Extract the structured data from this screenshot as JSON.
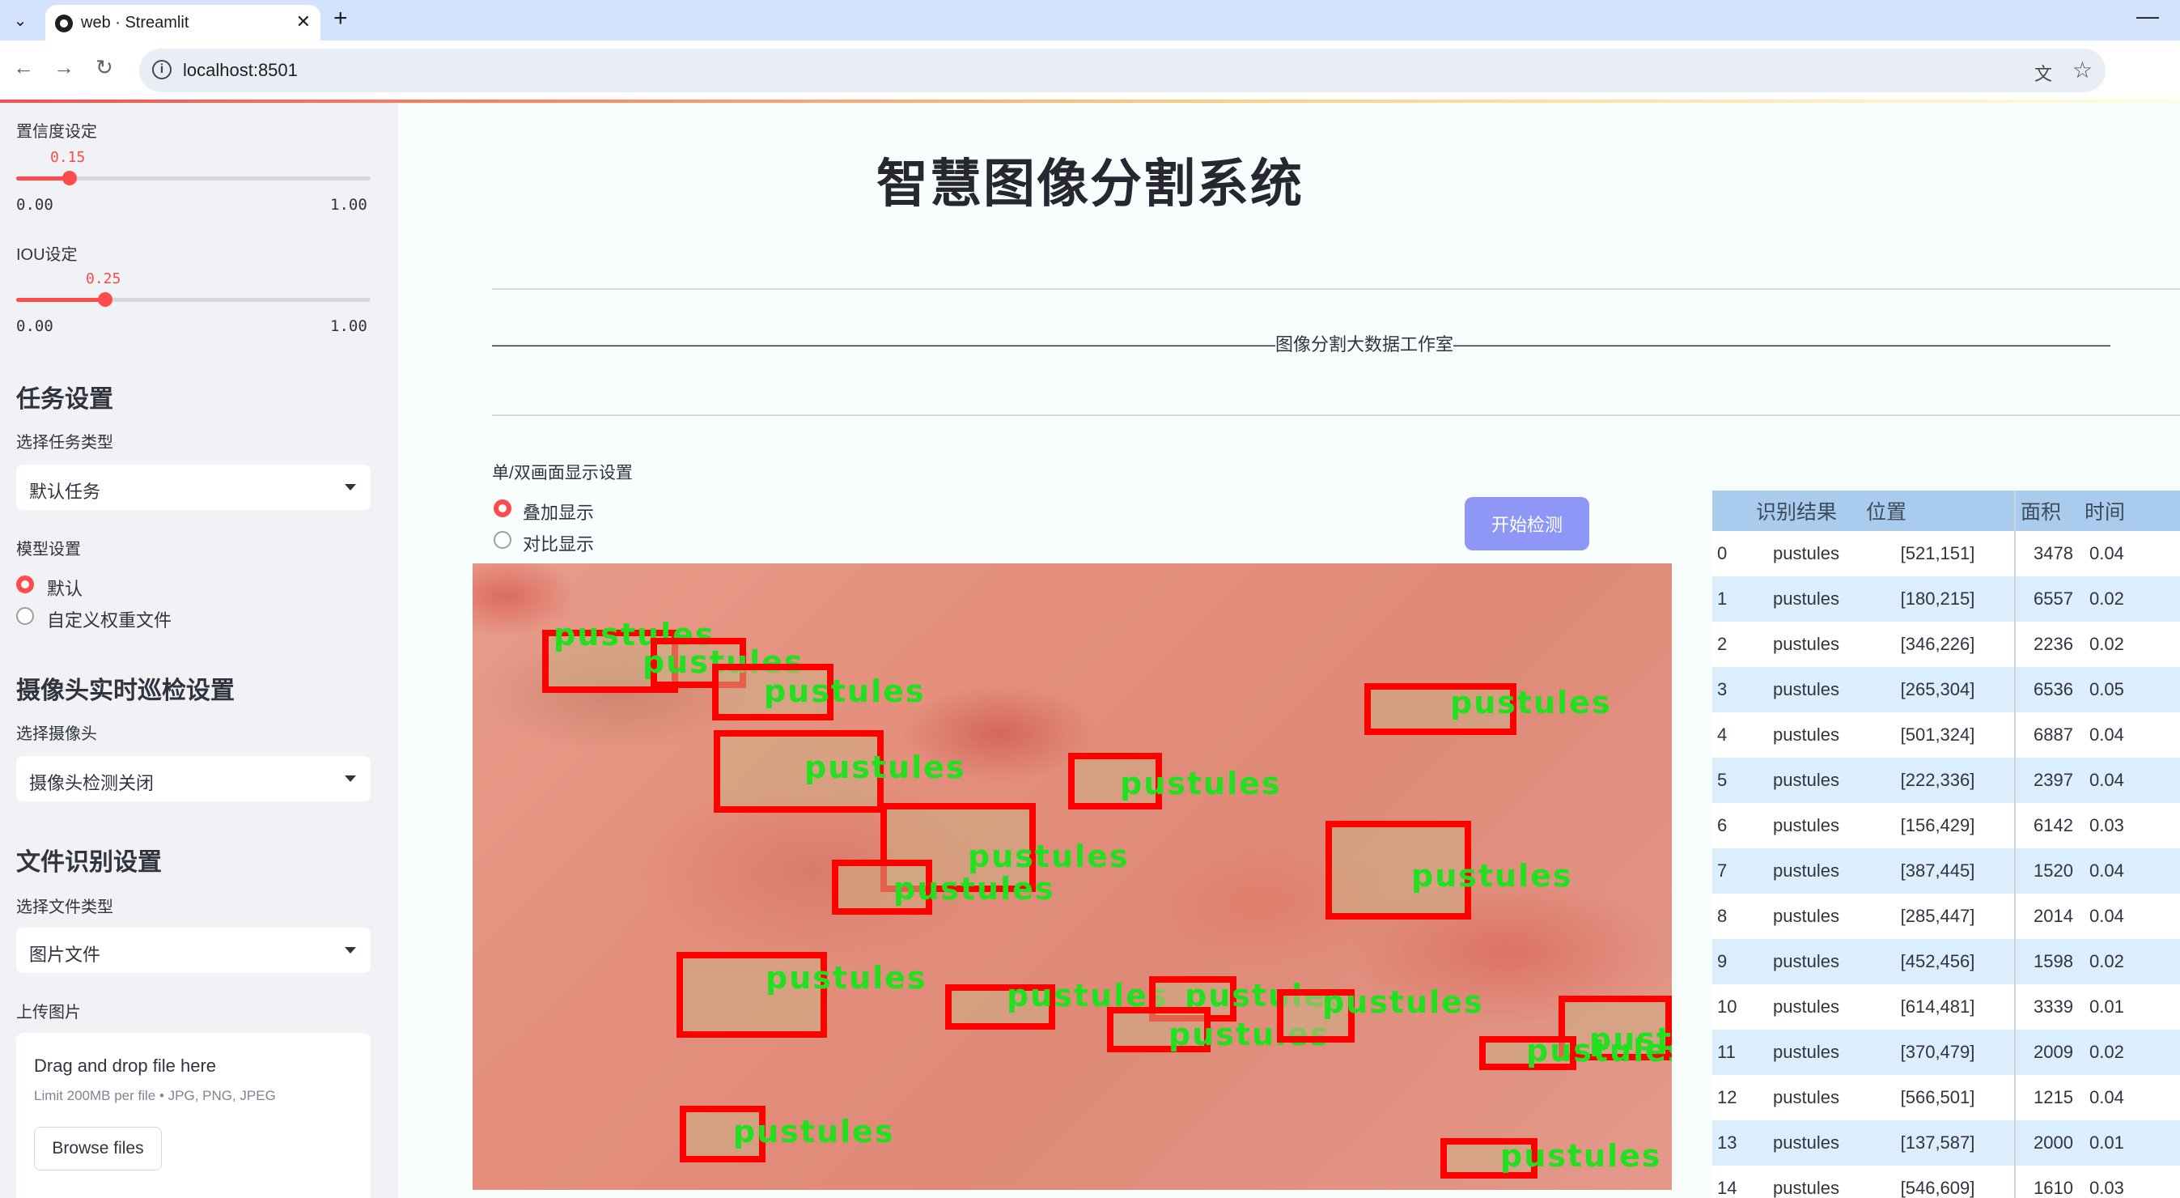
{
  "browser": {
    "tab_title": "web · Streamlit",
    "url": "localhost:8501",
    "menu_icon": "chevron-down-icon",
    "close_icon": "close-icon",
    "new_tab_icon": "plus-icon"
  },
  "sidebar": {
    "confidence_label": "置信度设定",
    "confidence_value": "0.15",
    "confidence_fraction": 0.15,
    "iou_label": "IOU设定",
    "iou_value": "0.25",
    "iou_fraction": 0.25,
    "slider_min": "0.00",
    "slider_max": "1.00",
    "task_heading": "任务设置",
    "task_type_label": "选择任务类型",
    "task_type_value": "默认任务",
    "model_label": "模型设置",
    "model_options": [
      "默认",
      "自定义权重文件"
    ],
    "model_selected": "默认",
    "camera_heading": "摄像头实时巡检设置",
    "camera_label": "选择摄像头",
    "camera_value": "摄像头检测关闭",
    "file_heading": "文件识别设置",
    "file_type_label": "选择文件类型",
    "file_type_value": "图片文件",
    "upload_label": "上传图片",
    "upload_title": "Drag and drop file here",
    "upload_limit": "Limit 200MB per file • JPG, PNG, JPEG",
    "browse_button": "Browse files"
  },
  "main": {
    "title": "智慧图像分割系统",
    "studio_line": "————————————————————————————————————————————图像分割大数据工作室———————————————————————————————————————————————",
    "display_label": "单/双画面显示设置",
    "display_options": [
      "叠加显示",
      "对比显示"
    ],
    "display_selected": "叠加显示",
    "start_button": "开始检测",
    "detection_label": "pustules"
  },
  "colors": {
    "accent": "#ff4b4b",
    "box": "#ff0000",
    "label": "#20e020",
    "button": "#8e97f5",
    "table_header": "#a9cbee"
  },
  "table": {
    "headers": [
      "识别结果",
      "位置",
      "面积",
      "时间"
    ],
    "rows": [
      {
        "idx": "0",
        "result": "pustules",
        "pos": "[521,151]",
        "area": "3478",
        "time": "0.04"
      },
      {
        "idx": "1",
        "result": "pustules",
        "pos": "[180,215]",
        "area": "6557",
        "time": "0.02"
      },
      {
        "idx": "2",
        "result": "pustules",
        "pos": "[346,226]",
        "area": "2236",
        "time": "0.02"
      },
      {
        "idx": "3",
        "result": "pustules",
        "pos": "[265,304]",
        "area": "6536",
        "time": "0.05"
      },
      {
        "idx": "4",
        "result": "pustules",
        "pos": "[501,324]",
        "area": "6887",
        "time": "0.04"
      },
      {
        "idx": "5",
        "result": "pustules",
        "pos": "[222,336]",
        "area": "2397",
        "time": "0.04"
      },
      {
        "idx": "6",
        "result": "pustules",
        "pos": "[156,429]",
        "area": "6142",
        "time": "0.03"
      },
      {
        "idx": "7",
        "result": "pustules",
        "pos": "[387,445]",
        "area": "1520",
        "time": "0.04"
      },
      {
        "idx": "8",
        "result": "pustules",
        "pos": "[285,447]",
        "area": "2014",
        "time": "0.04"
      },
      {
        "idx": "9",
        "result": "pustules",
        "pos": "[452,456]",
        "area": "1598",
        "time": "0.02"
      },
      {
        "idx": "10",
        "result": "pustules",
        "pos": "[614,481]",
        "area": "3339",
        "time": "0.01"
      },
      {
        "idx": "11",
        "result": "pustules",
        "pos": "[370,479]",
        "area": "2009",
        "time": "0.02"
      },
      {
        "idx": "12",
        "result": "pustules",
        "pos": "[566,501]",
        "area": "1215",
        "time": "0.04"
      },
      {
        "idx": "13",
        "result": "pustules",
        "pos": "[137,587]",
        "area": "2000",
        "time": "0.01"
      },
      {
        "idx": "14",
        "result": "pustules",
        "pos": "[546,609]",
        "area": "1610",
        "time": "0.03"
      }
    ]
  }
}
